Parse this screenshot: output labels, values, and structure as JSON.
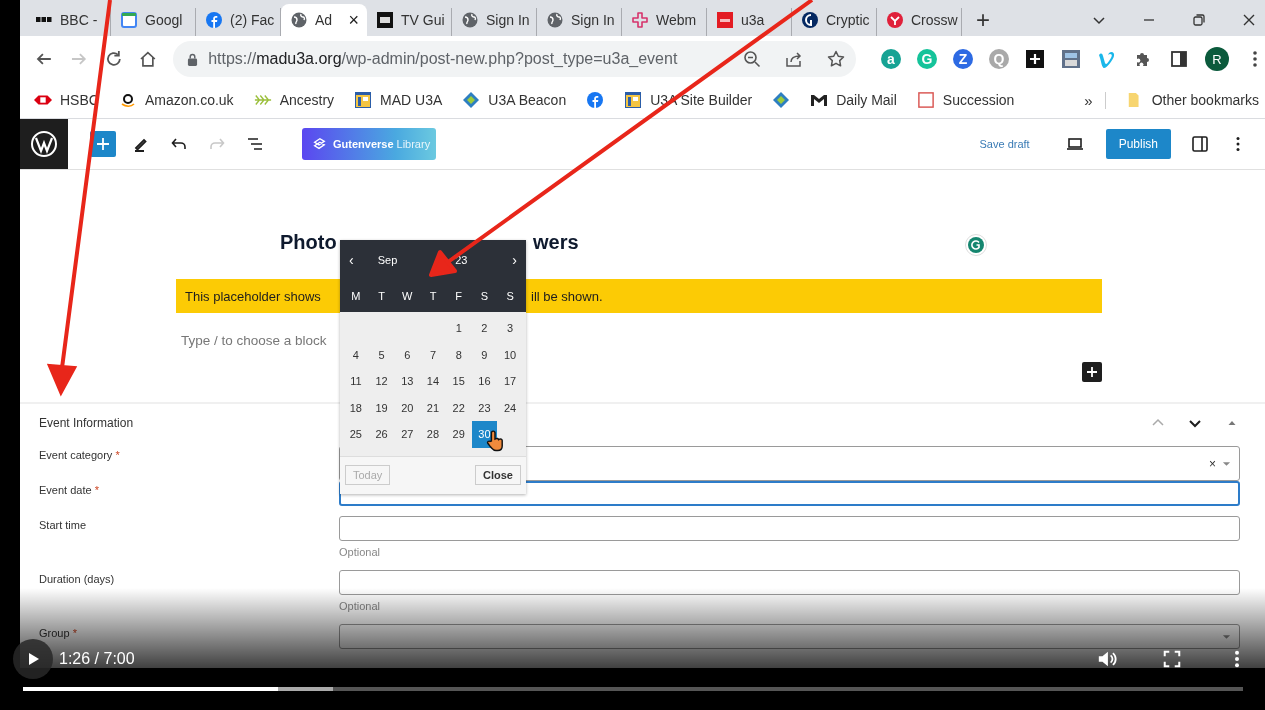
{
  "tabs": [
    {
      "label": "BBC -",
      "kind": "bbc",
      "selected": false
    },
    {
      "label": "Googl",
      "kind": "calendar",
      "selected": false
    },
    {
      "label": "(2) Fac",
      "kind": "facebook",
      "selected": false
    },
    {
      "label": "Ad",
      "kind": "globe",
      "selected": true,
      "close": "×"
    },
    {
      "label": "TV Gui",
      "kind": "tv",
      "selected": false
    },
    {
      "label": "Sign In",
      "kind": "globe",
      "selected": false
    },
    {
      "label": "Sign In",
      "kind": "globe",
      "selected": false
    },
    {
      "label": "Webm",
      "kind": "flower",
      "selected": false
    },
    {
      "label": "u3a",
      "kind": "redbox",
      "selected": false
    },
    {
      "label": "Cryptic",
      "kind": "navy",
      "selected": false
    },
    {
      "label": "Crossw",
      "kind": "redcircle",
      "selected": false
    }
  ],
  "new_tab": "+",
  "address": {
    "prefix": "https://",
    "host": "madu3a.org",
    "path": "/wp-admin/post-new.php?post_type=u3a_event"
  },
  "extensions": [
    {
      "label": "a",
      "color": "#16a394"
    },
    {
      "label": "G",
      "color": "#15c39a"
    },
    {
      "label": "Z",
      "color": "#2d6ae3"
    },
    {
      "label": "Q",
      "color": "#a9a9a9"
    }
  ],
  "profile": {
    "label": "R"
  },
  "bookmarks": [
    {
      "label": "HSBC",
      "kind": "hsbc"
    },
    {
      "label": "Amazon.co.uk",
      "kind": "amazon"
    },
    {
      "label": "Ancestry",
      "kind": "leaf"
    },
    {
      "label": "MAD U3A",
      "kind": "site"
    },
    {
      "label": "U3A Beacon",
      "kind": "beacon"
    },
    {
      "kind": "facebook"
    },
    {
      "label": "U3A Site Builder",
      "kind": "site"
    },
    {
      "kind": "beacon"
    },
    {
      "label": "Daily Mail",
      "kind": "mail"
    },
    {
      "label": "Succession",
      "kind": "frame"
    }
  ],
  "bookmarks_more": "»",
  "other_bookmarks": "Other bookmarks",
  "editor": {
    "library_brand": "Gutenverse",
    "library_label": "Library",
    "save_draft": "Save draft",
    "publish": "Publish",
    "title_start": "Photo",
    "title_end": "wers",
    "notice_start": "This placeholder shows",
    "notice_end": "ill be shown.",
    "block_prompt": "Type / to choose a block"
  },
  "calendar": {
    "prev": "‹",
    "month": "Sep",
    "year": "23",
    "next": "›",
    "weekdays": [
      "M",
      "T",
      "W",
      "T",
      "F",
      "S",
      "S"
    ],
    "weeks": [
      [
        {
          "label": "1",
          "selected": false
        },
        {
          "label": "2",
          "selected": false
        },
        {
          "label": "3",
          "selected": false
        }
      ],
      [
        {
          "label": "4",
          "selected": false
        },
        {
          "label": "5",
          "selected": false
        },
        {
          "label": "6",
          "selected": false
        },
        {
          "label": "7",
          "selected": false
        },
        {
          "label": "8",
          "selected": false
        },
        {
          "label": "9",
          "selected": false
        },
        {
          "label": "10",
          "selected": false
        }
      ],
      [
        {
          "label": "11",
          "selected": false
        },
        {
          "label": "12",
          "selected": false
        },
        {
          "label": "13",
          "selected": false
        },
        {
          "label": "14",
          "selected": false
        },
        {
          "label": "15",
          "selected": false
        },
        {
          "label": "16",
          "selected": false
        },
        {
          "label": "17",
          "selected": false
        }
      ],
      [
        {
          "label": "18",
          "selected": false
        },
        {
          "label": "19",
          "selected": false
        },
        {
          "label": "20",
          "selected": false
        },
        {
          "label": "21",
          "selected": false
        },
        {
          "label": "22",
          "selected": false
        },
        {
          "label": "23",
          "selected": false
        },
        {
          "label": "24",
          "selected": false
        }
      ],
      [
        {
          "label": "25",
          "selected": false
        },
        {
          "label": "26",
          "selected": false
        },
        {
          "label": "27",
          "selected": false
        },
        {
          "label": "28",
          "selected": false
        },
        {
          "label": "29",
          "selected": false
        },
        {
          "label": "30",
          "selected": true
        }
      ]
    ],
    "today": {
      "label": "Today",
      "disabled": true
    },
    "close": "Close"
  },
  "meta_box": {
    "title": "Event Information",
    "fields": [
      {
        "label": "Event category",
        "required_mark": "*",
        "kind": "select",
        "clear": "×",
        "focused": false
      },
      {
        "label": "Event date",
        "required_mark": "*",
        "kind": "text",
        "focused": true
      },
      {
        "label": "Start time",
        "kind": "text",
        "focused": false,
        "help": "Optional"
      },
      {
        "label": "Duration (days)",
        "kind": "text",
        "focused": false,
        "help": "Optional"
      },
      {
        "label": "Group",
        "required_mark": "*",
        "kind": "select",
        "focused": false
      }
    ]
  },
  "player": {
    "playing": false,
    "time": "1:26 / 7:00",
    "progress": {
      "level": 0.209
    },
    "buffer": {
      "level": 0.254
    }
  }
}
